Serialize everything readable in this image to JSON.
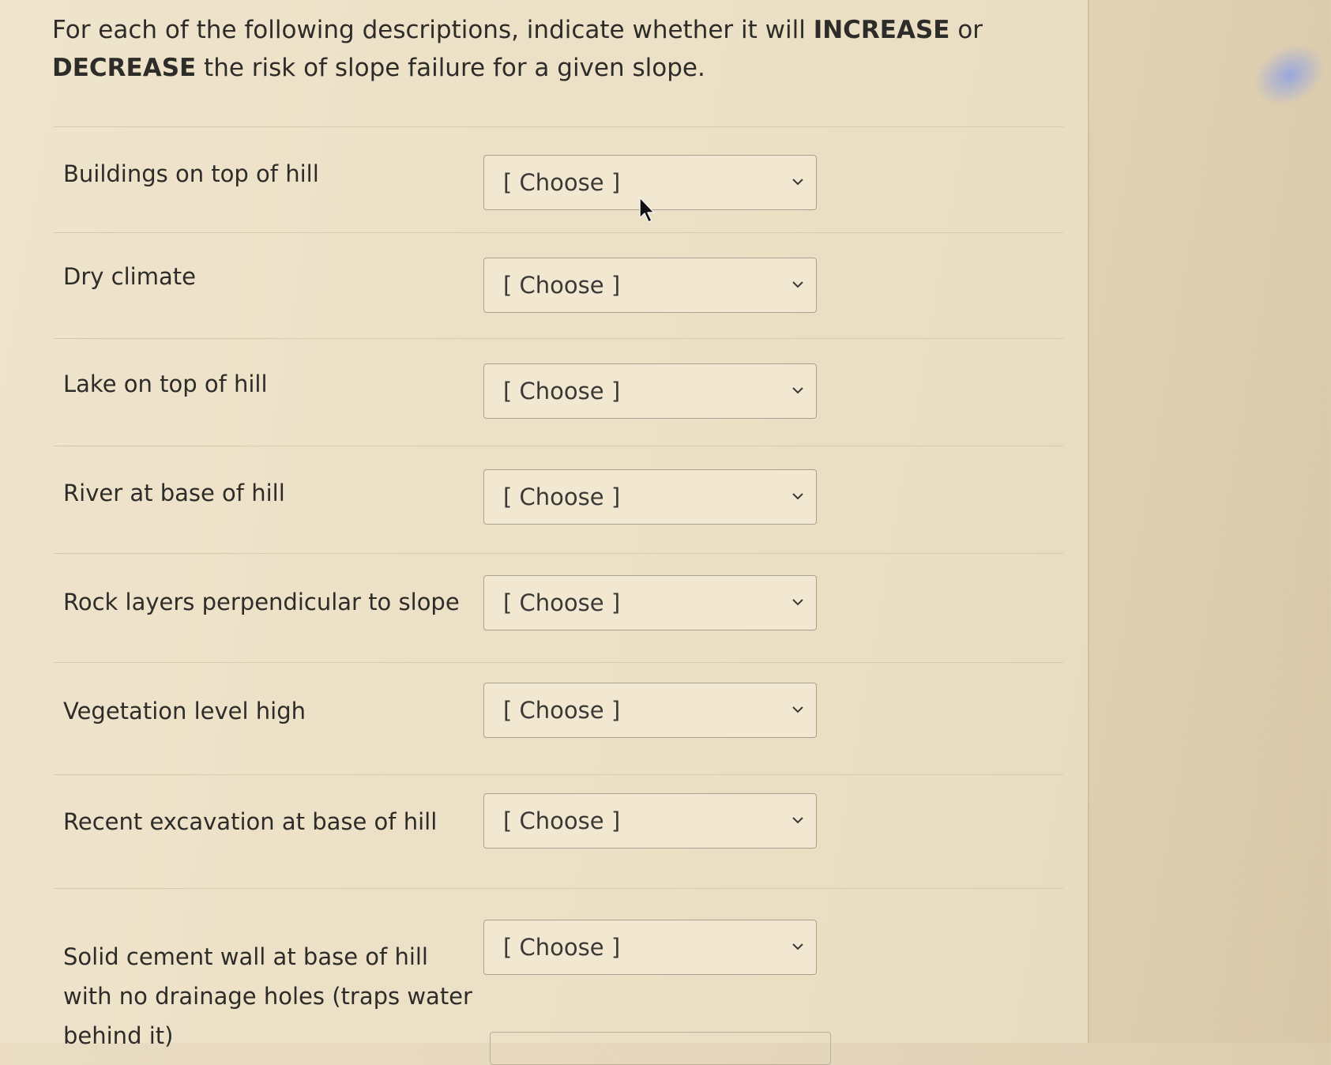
{
  "question": {
    "part1": "For each of the following descriptions, indicate whether it will ",
    "increase": "INCREASE",
    "or": " or ",
    "decrease": "DECREASE",
    "part2": " the risk of slope failure for a given slope."
  },
  "rows": [
    {
      "label": "Buildings on top of hill",
      "value": "[ Choose ]"
    },
    {
      "label": "Dry climate",
      "value": "[ Choose ]"
    },
    {
      "label": "Lake on top of hill",
      "value": "[ Choose ]"
    },
    {
      "label": "River at base of hill",
      "value": "[ Choose ]"
    },
    {
      "label": "Rock layers perpendicular to slope",
      "value": "[ Choose ]"
    },
    {
      "label": "Vegetation level high",
      "value": "[ Choose ]"
    },
    {
      "label": "Recent excavation at base of hill",
      "value": "[ Choose ]"
    },
    {
      "label": "Solid cement wall at base of hill with no drainage holes (traps water behind it)",
      "value": "[ Choose ]"
    }
  ],
  "icons": {
    "dropdown": "chevron-down-icon",
    "pointer": "mouse-cursor-icon"
  }
}
